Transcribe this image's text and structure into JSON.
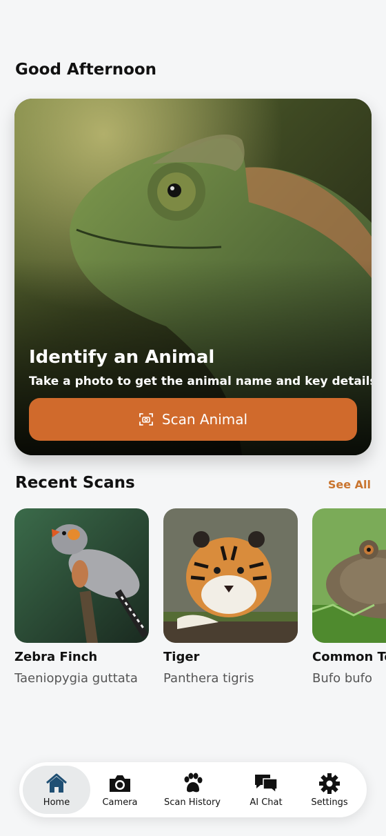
{
  "greeting": "Good Afternoon",
  "hero": {
    "title": "Identify an Animal",
    "subtitle": "Take a photo to get the animal name and key details.",
    "button_label": "Scan Animal",
    "button_icon": "camera-scan-icon",
    "image": "chameleon-photo"
  },
  "recent": {
    "title": "Recent Scans",
    "see_all": "See All",
    "items": [
      {
        "name": "Zebra Finch",
        "scientific": "Taeniopygia guttata",
        "image": "zebra-finch-photo"
      },
      {
        "name": "Tiger",
        "scientific": "Panthera tigris",
        "image": "tiger-photo"
      },
      {
        "name": "Common Toad",
        "scientific": "Bufo bufo",
        "image": "toad-photo"
      }
    ]
  },
  "tabs": [
    {
      "label": "Home",
      "icon": "home-icon",
      "active": true
    },
    {
      "label": "Camera",
      "icon": "camera-icon",
      "active": false
    },
    {
      "label": "Scan History",
      "icon": "paw-icon",
      "active": false
    },
    {
      "label": "AI Chat",
      "icon": "chat-bubbles-icon",
      "active": false
    },
    {
      "label": "Settings",
      "icon": "gear-icon",
      "active": false
    }
  ],
  "colors": {
    "accent": "#d06a2c",
    "see_all": "#c9752f",
    "background": "#f5f6f7",
    "home_icon": "#1f4f73"
  }
}
